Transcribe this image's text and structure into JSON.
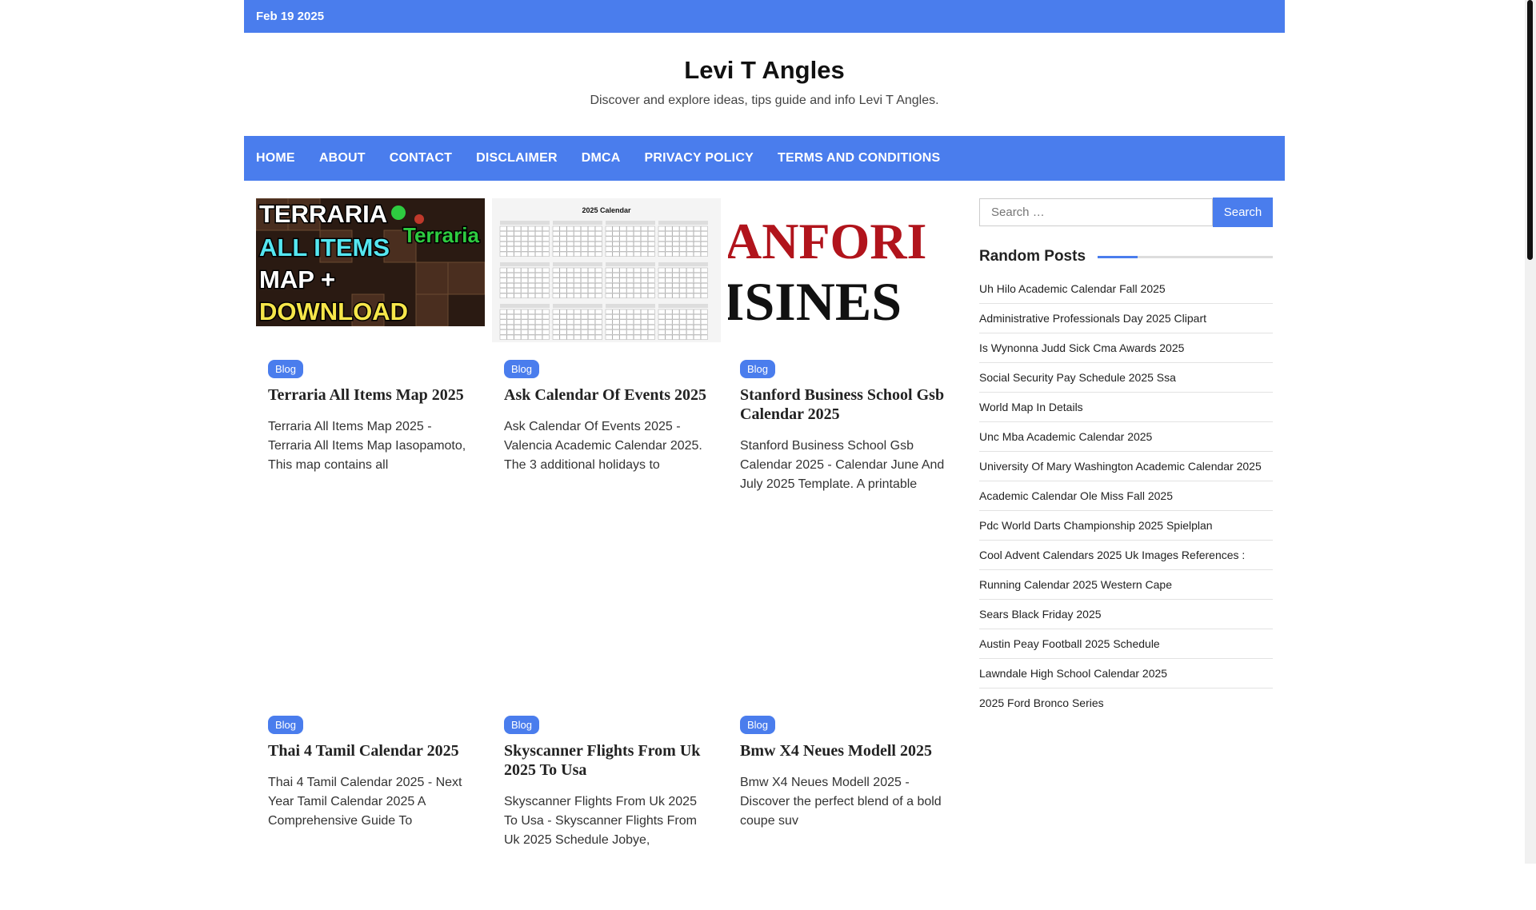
{
  "topbar": {
    "date": "Feb 19 2025"
  },
  "site": {
    "title": "Levi T Angles",
    "description": "Discover and explore ideas, tips guide and info Levi T Angles."
  },
  "nav": [
    "HOME",
    "ABOUT",
    "CONTACT",
    "DISCLAIMER",
    "DMCA",
    "PRIVACY POLICY",
    "TERMS AND CONDITIONS"
  ],
  "posts": [
    {
      "category": "Blog",
      "title": "Terraria All Items Map 2025",
      "excerpt": "Terraria All Items Map 2025 - Terraria All Items Map Iasopamoto, This map contains all",
      "thumb": {
        "lines": [
          "TERRARIA",
          "ALL ITEMS",
          "MAP +",
          "DOWNLOAD"
        ],
        "logo": "Terraria"
      }
    },
    {
      "category": "Blog",
      "title": "Ask Calendar Of Events 2025",
      "excerpt": "Ask Calendar Of Events 2025 - Valencia Academic Calendar 2025. The 3 additional holidays to",
      "thumb": {
        "title": "2025 Calendar"
      }
    },
    {
      "category": "Blog",
      "title": "Stanford Business School Gsb Calendar 2025",
      "excerpt": "Stanford Business School Gsb Calendar 2025 - Calendar June And July 2025 Template. A printable",
      "thumb": {
        "lines": [
          "ANFORI",
          "ISINES"
        ]
      }
    },
    {
      "category": "Blog",
      "title": "Thai 4 Tamil Calendar 2025",
      "excerpt": "Thai 4 Tamil Calendar 2025 - Next Year Tamil Calendar 2025 A Comprehensive Guide To"
    },
    {
      "category": "Blog",
      "title": "Skyscanner Flights From Uk 2025 To Usa",
      "excerpt": "Skyscanner Flights From Uk 2025 To Usa - Skyscanner Flights From Uk 2025 Schedule Jobye,"
    },
    {
      "category": "Blog",
      "title": "Bmw X4 Neues Modell 2025",
      "excerpt": "Bmw X4 Neues Modell 2025 - Discover the perfect blend of a bold coupe suv"
    }
  ],
  "search": {
    "placeholder": "Search …",
    "button": "Search"
  },
  "random_posts": {
    "title": "Random Posts",
    "items": [
      "Uh Hilo Academic Calendar Fall 2025",
      "Administrative Professionals Day 2025 Clipart",
      "Is Wynonna Judd Sick Cma Awards 2025",
      "Social Security Pay Schedule 2025 Ssa",
      "World Map In Details",
      "Unc Mba Academic Calendar 2025",
      "University Of Mary Washington Academic Calendar 2025",
      "Academic Calendar Ole Miss Fall 2025",
      "Pdc World Darts Championship 2025 Spielplan",
      "Cool Advent Calendars 2025 Uk Images References :",
      "Running Calendar 2025 Western Cape",
      "Sears Black Friday 2025",
      "Austin Peay Football 2025 Schedule",
      "Lawndale High School Calendar 2025",
      "2025 Ford Bronco Series"
    ]
  }
}
